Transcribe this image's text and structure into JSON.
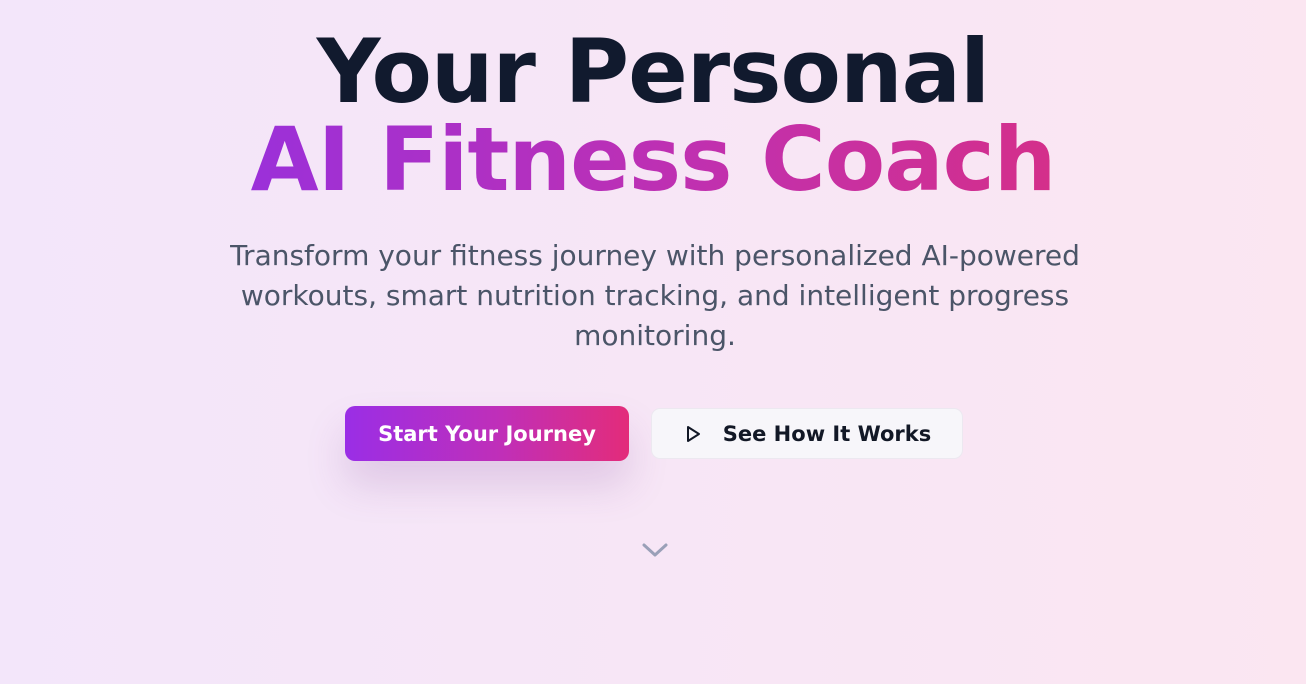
{
  "hero": {
    "title_line_1": "Your Personal",
    "title_line_2": "AI Fitness Coach",
    "subtitle": "Transform your fitness journey with personalized AI-powered workouts, smart nutrition tracking, and intelligent progress monitoring."
  },
  "actions": {
    "primary_label": "Start Your Journey",
    "secondary_label": "See How It Works",
    "secondary_icon": "play-icon"
  },
  "scroll_indicator": {
    "icon": "chevron-down-icon"
  },
  "colors": {
    "title": "#111a2e",
    "gradient_start": "#9b30d9",
    "gradient_end": "#e32c7a",
    "subtitle": "#4b5568",
    "chevron": "#9aa0b8"
  }
}
